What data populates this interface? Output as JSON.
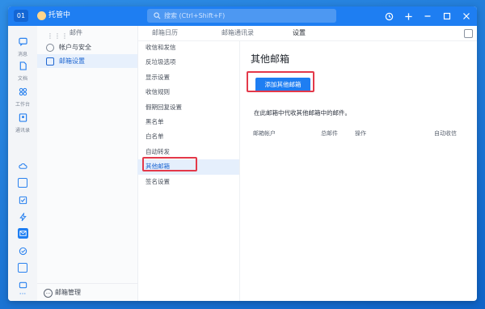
{
  "titlebar": {
    "badge": "01",
    "user": "托管中",
    "search_placeholder": "搜索 (Ctrl+Shift+F)"
  },
  "rail": {
    "items": [
      {
        "label": "消息"
      },
      {
        "label": "文档"
      },
      {
        "label": "工作台"
      },
      {
        "label": "通讯录"
      }
    ]
  },
  "nav": {
    "header": "邮件",
    "items": [
      {
        "label": "帐户与安全"
      },
      {
        "label": "邮箱设置"
      }
    ],
    "footer": "邮箱管理"
  },
  "tabs": [
    {
      "label": "邮箱日历"
    },
    {
      "label": "邮箱通讯录"
    },
    {
      "label": "设置"
    }
  ],
  "settings_menu": [
    {
      "label": "收信和发信"
    },
    {
      "label": "反垃圾选项"
    },
    {
      "label": "显示设置"
    },
    {
      "label": "收信规则"
    },
    {
      "label": "假期回复设置"
    },
    {
      "label": "黑名单"
    },
    {
      "label": "白名单"
    },
    {
      "label": "自动转发"
    },
    {
      "label": "其他邮箱"
    },
    {
      "label": "签名设置"
    }
  ],
  "content": {
    "title": "其他邮箱",
    "add_button": "添加其他邮箱",
    "description": "在此邮箱中代收其他邮箱中的邮件。",
    "table_headers": [
      "邮箱帐户",
      "总邮件",
      "操作",
      "自动收信"
    ]
  },
  "colors": {
    "accent": "#1e7ef2",
    "highlight": "#e3394a"
  }
}
